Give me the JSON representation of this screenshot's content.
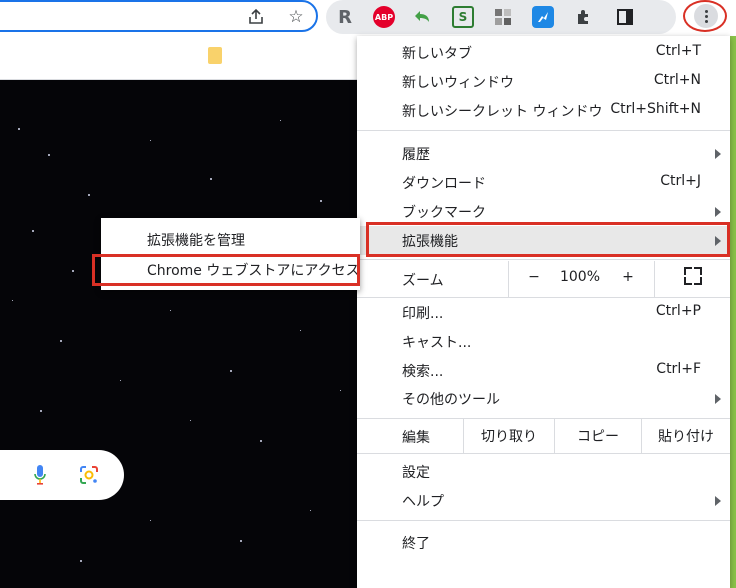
{
  "menu": {
    "new_tab": {
      "label": "新しいタブ",
      "shortcut": "Ctrl+T"
    },
    "new_window": {
      "label": "新しいウィンドウ",
      "shortcut": "Ctrl+N"
    },
    "new_incognito": {
      "label": "新しいシークレット ウィンドウ",
      "shortcut": "Ctrl+Shift+N"
    },
    "history": {
      "label": "履歴"
    },
    "downloads": {
      "label": "ダウンロード",
      "shortcut": "Ctrl+J"
    },
    "bookmarks": {
      "label": "ブックマーク"
    },
    "extensions": {
      "label": "拡張機能"
    },
    "zoom": {
      "label": "ズーム",
      "minus": "−",
      "level": "100%",
      "plus": "+"
    },
    "print": {
      "label": "印刷...",
      "shortcut": "Ctrl+P"
    },
    "cast": {
      "label": "キャスト..."
    },
    "find": {
      "label": "検索...",
      "shortcut": "Ctrl+F"
    },
    "more_tools": {
      "label": "その他のツール"
    },
    "edit": {
      "label": "編集",
      "cut": "切り取り",
      "copy": "コピー",
      "paste": "貼り付け"
    },
    "settings": {
      "label": "設定"
    },
    "help": {
      "label": "ヘルプ"
    },
    "exit": {
      "label": "終了"
    }
  },
  "submenu": {
    "manage_extensions": "拡張機能を管理",
    "visit_store": "Chrome ウェブストアにアクセス"
  },
  "extensions_bar": {
    "r_ext": "R",
    "abp_ext": "ABP",
    "s_ext": "S"
  },
  "colors": {
    "highlight_border": "#d93025",
    "menu_hover": "#e8e8e8",
    "omnibox_focus": "#1a73e8"
  }
}
